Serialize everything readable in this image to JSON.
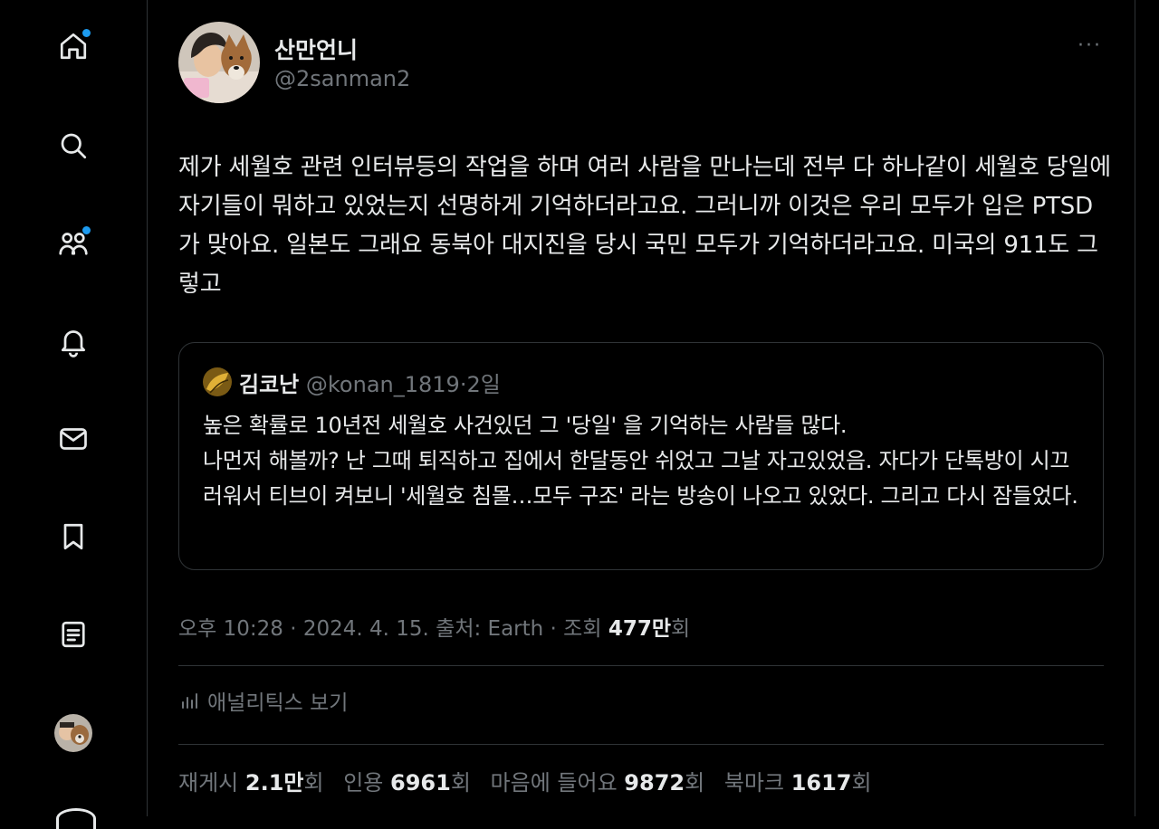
{
  "sidebar": {
    "items": [
      {
        "name": "home",
        "icon": "home-icon",
        "badge": true
      },
      {
        "name": "explore",
        "icon": "search-icon",
        "badge": false
      },
      {
        "name": "communities",
        "icon": "people-icon",
        "badge": true
      },
      {
        "name": "notifications",
        "icon": "bell-icon",
        "badge": false
      },
      {
        "name": "messages",
        "icon": "mail-icon",
        "badge": false
      },
      {
        "name": "bookmarks",
        "icon": "bookmark-icon",
        "badge": false
      },
      {
        "name": "lists",
        "icon": "list-icon",
        "badge": false
      }
    ]
  },
  "tweet": {
    "author_name": "산만언니",
    "author_handle": "@2sanman2",
    "more_label": "···",
    "text": "제가 세월호 관련 인터뷰등의 작업을 하며 여러 사람을 만나는데 전부 다 하나같이 세월호 당일에 자기들이 뭐하고 있었는지 선명하게 기억하더라고요. 그러니까 이것은 우리 모두가 입은 PTSD 가 맞아요. 일본도 그래요 동북아 대지진을 당시 국민 모두가 기억하더라고요. 미국의 911도 그렇고",
    "quote": {
      "author_name": "김코난",
      "author_handle": "@konan_1819",
      "separator": "·",
      "time": "2일",
      "text": "높은 확률로 10년전 세월호 사건있던 그 '당일' 을 기억하는 사람들 많다.\n나먼저 해볼까? 난 그때 퇴직하고 집에서 한달동안 쉬었고 그날 자고있었음. 자다가 단톡방이 시끄러워서 티브이 켜보니 '세월호 침몰…모두 구조' 라는 방송이 나오고 있었다. 그리고 다시 잠들었다."
    },
    "meta": {
      "time": "오후 10:28",
      "sep1": " · ",
      "date": "2024. 4. 15.",
      "sep2": " ",
      "source_label": "출처: Earth",
      "sep3": " · ",
      "views_label": "조회 ",
      "views_value": "477만",
      "views_unit": "회"
    },
    "analytics_label": "애널리틱스 보기",
    "stats": {
      "retweets_label": "재게시 ",
      "retweets_value": "2.1만",
      "retweets_unit": "회",
      "quotes_label": "인용 ",
      "quotes_value": "6961",
      "quotes_unit": "회",
      "likes_label": "마음에 들어요 ",
      "likes_value": "9872",
      "likes_unit": "회",
      "bookmarks_label": "북마크 ",
      "bookmarks_value": "1617",
      "bookmarks_unit": "회"
    }
  },
  "colors": {
    "background": "#000000",
    "text": "#e7e9ea",
    "secondary": "#71767b",
    "border": "#2f3336",
    "accent": "#1d9bf0"
  }
}
